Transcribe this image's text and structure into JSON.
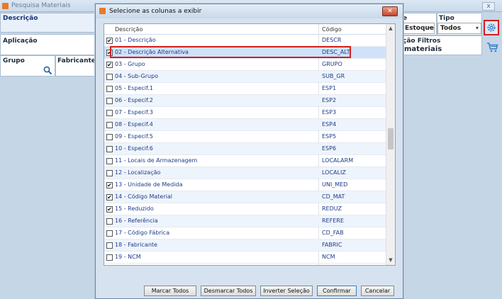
{
  "background": {
    "title": "Pesquisa Materiais",
    "close_glyph": "x",
    "labels": {
      "descricao": "Descrição",
      "aplicacao": "Aplicação",
      "grupo": "Grupo",
      "fabricante": "Fabricante",
      "e": "e",
      "tipo": "Tipo",
      "filtros": "ção Filtros",
      "materiais": "materiais"
    },
    "combos": {
      "estoque": "Estoque",
      "todos": "Todos"
    }
  },
  "dialog": {
    "title": "Selecione as colunas a exibir",
    "close_glyph": "✕",
    "columns": {
      "descricao": "Descrição",
      "codigo": "Código"
    },
    "rows": [
      {
        "desc": "01 - Descrição",
        "code": "DESCR",
        "checked": true
      },
      {
        "desc": "02 - Descrição Alternativa",
        "code": "DESC_ALT",
        "checked": true
      },
      {
        "desc": "03 - Grupo",
        "code": "GRUPO",
        "checked": true
      },
      {
        "desc": "04 - Sub-Grupo",
        "code": "SUB_GR",
        "checked": false
      },
      {
        "desc": "05 - Especif.1",
        "code": "ESP1",
        "checked": false
      },
      {
        "desc": "06 - Especif.2",
        "code": "ESP2",
        "checked": false
      },
      {
        "desc": "07 - Especif.3",
        "code": "ESP3",
        "checked": false
      },
      {
        "desc": "08 - Especif.4",
        "code": "ESP4",
        "checked": false
      },
      {
        "desc": "09 - Especif.5",
        "code": "ESP5",
        "checked": false
      },
      {
        "desc": "10 - Especif.6",
        "code": "ESP6",
        "checked": false
      },
      {
        "desc": "11 - Locais de Armazenagem",
        "code": "LOCALARM",
        "checked": false
      },
      {
        "desc": "12 - Localização",
        "code": "LOCALIZ",
        "checked": false
      },
      {
        "desc": "13 - Unidade de Medida",
        "code": "UNI_MED",
        "checked": true
      },
      {
        "desc": "14 - Código Material",
        "code": "CD_MAT",
        "checked": true
      },
      {
        "desc": "15 - Reduzido",
        "code": "REDUZ",
        "checked": true
      },
      {
        "desc": "16 - Referência",
        "code": "REFERE",
        "checked": false
      },
      {
        "desc": "17 - Código Fábrica",
        "code": "CD_FAB",
        "checked": false
      },
      {
        "desc": "18 - Fabricante",
        "code": "FABRIC",
        "checked": false
      },
      {
        "desc": "19 - NCM",
        "code": "NCM",
        "checked": false
      }
    ],
    "buttons": {
      "marcar": "Marcar Todos",
      "desmarcar": "Desmarcar Todos",
      "inverter": "Inverter Seleção",
      "confirmar": "Confirmar",
      "cancelar": "Cancelar"
    }
  },
  "icons": {
    "settings": "gear-icon",
    "search": "search-icon",
    "cart": "cart-icon",
    "checkbox_checked": "✔"
  },
  "colors": {
    "highlight": "#d41f1f",
    "row_text": "#1d3b8a",
    "selected_row": "#cfe2fa"
  }
}
